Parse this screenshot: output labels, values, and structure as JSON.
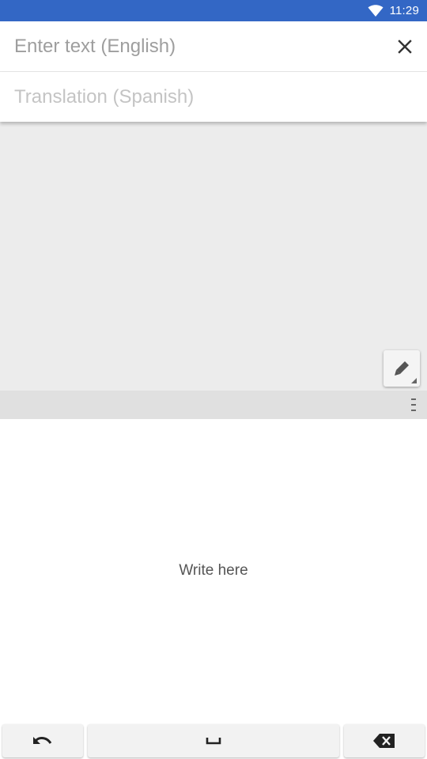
{
  "status_bar": {
    "time": "11:29",
    "background": "#3367c5",
    "icons": [
      "wifi-icon"
    ]
  },
  "source_input": {
    "placeholder": "Enter text (English)",
    "value": "",
    "clear_icon": "close-icon"
  },
  "translation": {
    "placeholder": "Translation (Spanish)"
  },
  "handwriting": {
    "pen_icon": "pen-icon",
    "menu_icon": "menu-handle-icon",
    "hint": "Write here"
  },
  "keyboard": {
    "keys": [
      {
        "name": "undo",
        "icon": "undo-icon"
      },
      {
        "name": "space",
        "icon": "space-icon"
      },
      {
        "name": "backspace",
        "icon": "backspace-icon"
      }
    ]
  }
}
